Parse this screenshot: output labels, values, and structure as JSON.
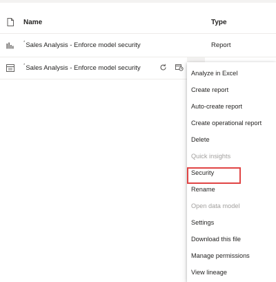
{
  "table": {
    "headers": {
      "name": "Name",
      "type": "Type"
    },
    "rows": [
      {
        "icon": "report-icon",
        "name": "Sales Analysis - Enforce model security",
        "type": "Report",
        "indicator": "*"
      },
      {
        "icon": "dataset-icon",
        "name": "Sales Analysis - Enforce model security",
        "type": "",
        "indicator": "*"
      }
    ]
  },
  "context_menu": {
    "items": [
      {
        "label": "Analyze in Excel",
        "disabled": false
      },
      {
        "label": "Create report",
        "disabled": false
      },
      {
        "label": "Auto-create report",
        "disabled": false
      },
      {
        "label": "Create operational report",
        "disabled": false
      },
      {
        "label": "Delete",
        "disabled": false
      },
      {
        "label": "Quick insights",
        "disabled": true
      },
      {
        "label": "Security",
        "disabled": false,
        "highlighted": true
      },
      {
        "label": "Rename",
        "disabled": false
      },
      {
        "label": "Open data model",
        "disabled": true
      },
      {
        "label": "Settings",
        "disabled": false
      },
      {
        "label": "Download this file",
        "disabled": false
      },
      {
        "label": "Manage permissions",
        "disabled": false
      },
      {
        "label": "View lineage",
        "disabled": false
      }
    ]
  },
  "colors": {
    "highlight_border": "#e04343",
    "disabled_text": "#a19f9d",
    "text": "#252423"
  }
}
